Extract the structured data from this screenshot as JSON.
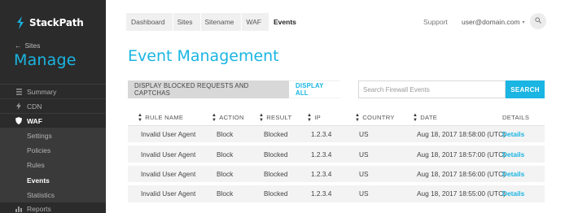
{
  "brand": {
    "name": "StackPath",
    "accent": "#1ab5e2"
  },
  "sidebar": {
    "back_label": "Sites",
    "section_title": "Manage",
    "items": [
      {
        "label": "Summary",
        "icon": "summary-icon"
      },
      {
        "label": "CDN",
        "icon": "bolt-icon"
      },
      {
        "label": "WAF",
        "icon": "shield-icon",
        "active": true
      }
    ],
    "sub_items": [
      {
        "label": "Settings"
      },
      {
        "label": "Policies"
      },
      {
        "label": "Rules"
      },
      {
        "label": "Events",
        "active": true
      },
      {
        "label": "Statistics"
      }
    ],
    "after_items": [
      {
        "label": "Reports",
        "icon": "bar-chart-icon"
      }
    ]
  },
  "breadcrumb": [
    "Dashboard",
    "Sites",
    "Sitename",
    "WAF",
    "Events"
  ],
  "header": {
    "support_label": "Support",
    "user_label": "user@domain.com",
    "search_icon": "search-icon"
  },
  "page": {
    "title": "Event Management"
  },
  "filters": {
    "blocked_label": "DISPLAY BLOCKED REQUESTS AND CAPTCHAS",
    "all_label": "DISPLAY ALL",
    "search_placeholder": "Search Firewall Events",
    "search_button": "SEARCH"
  },
  "table": {
    "columns": [
      "RULE NAME",
      "ACTION",
      "RESULT",
      "IP",
      "COUNTRY",
      "DATE",
      "DETAILS"
    ],
    "rows": [
      {
        "rule": "Invalid User Agent",
        "action": "Block",
        "result": "Blocked",
        "ip": "1.2.3.4",
        "country": "US",
        "date": "Aug 18, 2017 18:58:00 (UTC)",
        "details": "Details"
      },
      {
        "rule": "Invalid User Agent",
        "action": "Block",
        "result": "Blocked",
        "ip": "1.2.3.4",
        "country": "US",
        "date": "Aug 18, 2017 18:57:00 (UTC)",
        "details": "Details"
      },
      {
        "rule": "Invalid User Agent",
        "action": "Block",
        "result": "Blocked",
        "ip": "1.2.3.4",
        "country": "US",
        "date": "Aug 18, 2017 18:56:00 (UTC)",
        "details": "Details"
      },
      {
        "rule": "Invalid User Agent",
        "action": "Block",
        "result": "Blocked",
        "ip": "1.2.3.4",
        "country": "US",
        "date": "Aug 18, 2017 18:55:00 (UTC)",
        "details": "Details"
      }
    ]
  }
}
